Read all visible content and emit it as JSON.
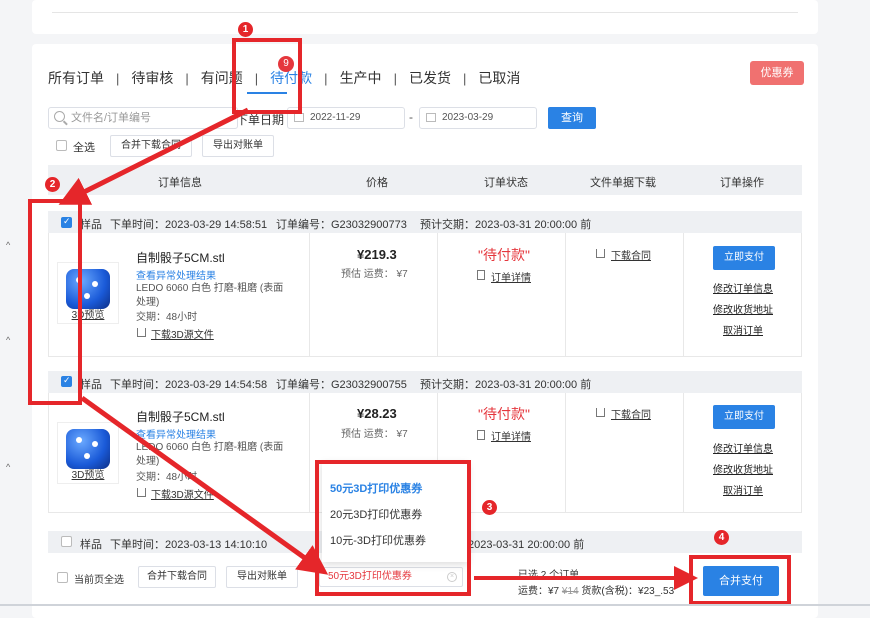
{
  "tabs": [
    "所有订单",
    "待审核",
    "有问题",
    "待付款",
    "生产中",
    "已发货",
    "已取消"
  ],
  "tabs_active": "待付款",
  "tab_badge": "9",
  "coupon_button": "优惠券",
  "search_placeholder": "文件名/订单编号",
  "date_label": "下单日期",
  "date_from": "2022-11-29",
  "date_separator": "-",
  "date_to": "2023-03-29",
  "query_button": "查询",
  "select_all": "全选",
  "merge_download_contract": "合并下载合同",
  "export_statement": "导出对账单",
  "table_headers": [
    "订单信息",
    "价格",
    "订单状态",
    "文件单据下载",
    "订单操作"
  ],
  "orders": [
    {
      "sample": "样品",
      "time": "下单时间：2023-03-29 14:58:51",
      "number": "订单编号：G23032900773",
      "expected": "预计交期：2023-03-31 20:00:00 前",
      "product": "自制骰子5CM.stl",
      "abnormal_link": "查看异常处理结果",
      "material": "LEDO 6060  白色  打磨-粗磨 (表面处理)",
      "delivery": "交期：48小时",
      "download_3d": "下载3D源文件",
      "preview": "3D预览",
      "price": "¥219.3",
      "shipping": "预估 运费： ¥7",
      "status": "\"待付款\"",
      "detail": "订单详情",
      "contract": "下载合同",
      "pay": "立即支付",
      "ops": [
        "修改订单信息",
        "修改收货地址",
        "取消订单"
      ]
    },
    {
      "sample": "样品",
      "time": "下单时间：2023-03-29 14:54:58",
      "number": "订单编号：G23032900755",
      "expected": "预计交期：2023-03-31 20:00:00 前",
      "product": "自制骰子5CM.stl",
      "abnormal_link": "查看异常处理结果",
      "material": "LEDO 6060  白色  打磨-粗磨 (表面处理)",
      "delivery": "交期：48小时",
      "download_3d": "下载3D源文件",
      "preview": "3D预览",
      "price": "¥28.23",
      "shipping": "预估 运费： ¥7",
      "status": "\"待付款\"",
      "detail": "订单详情",
      "contract": "下载合同",
      "pay": "立即支付",
      "ops": [
        "修改订单信息",
        "修改收货地址",
        "取消订单"
      ]
    },
    {
      "sample": "样品",
      "time": "下单时间：2023-03-13 14:10:10",
      "expected": "2023-03-31 20:00:00 前"
    }
  ],
  "footer": {
    "select_page": "当前页全选",
    "merge_download_contract": "合并下载合同",
    "export_statement": "导出对账单",
    "coupon_selected": "50元3D打印优惠券",
    "coupon_clear": "×",
    "summary_line1": "已选 2 个订单",
    "freight": "运费：¥7",
    "freight_old": "¥14",
    "total": "货款(含税)：¥23_.53",
    "merge_pay": "合并支付"
  },
  "coupon_options": [
    "50元3D打印优惠券",
    "20元3D打印优惠券",
    "10元-3D打印优惠券"
  ],
  "markers": [
    "1",
    "2",
    "3",
    "4"
  ],
  "left_carets": [
    "^",
    "^",
    "^"
  ],
  "accent": "#2a82e4",
  "alert": "#e5262a"
}
